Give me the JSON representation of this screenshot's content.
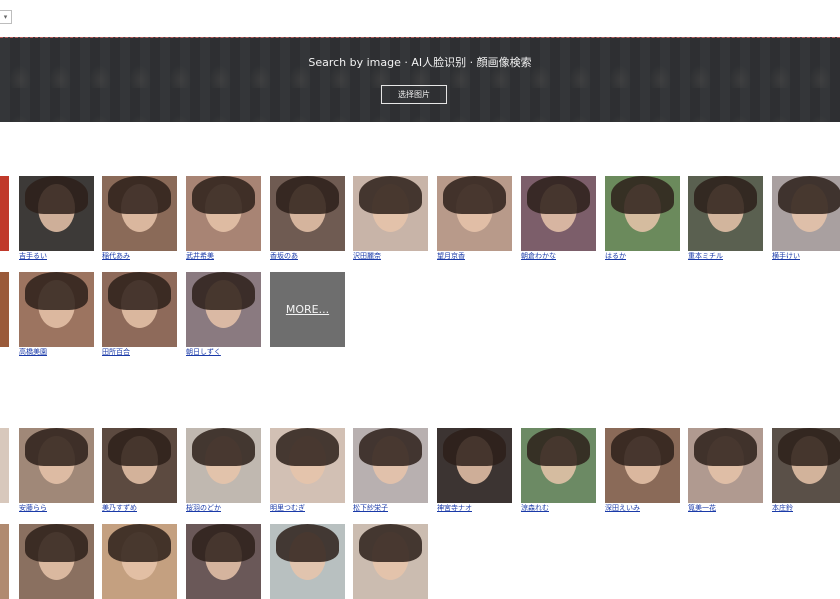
{
  "topbar": {
    "select_glyph": "▾"
  },
  "banner": {
    "title": "Search by image · AI人脸识别 · 顔画像検索",
    "button": "选择图片"
  },
  "sections": [
    {
      "rows": [
        {
          "cards": [
            {
              "name": "吉手るい",
              "photo": "#3d3a38"
            },
            {
              "name": "稲代あみ",
              "photo": "#8a6a58"
            },
            {
              "name": "武井希美",
              "photo": "#a88474"
            },
            {
              "name": "香坂のあ",
              "photo": "#6f5b52"
            },
            {
              "name": "沢田麗奈",
              "photo": "#c8b4a8"
            },
            {
              "name": "望月京香",
              "photo": "#b89a8a"
            },
            {
              "name": "朝倉わかな",
              "photo": "#7c5e6a"
            },
            {
              "name": "はるか",
              "photo": "#6b8a5c"
            },
            {
              "name": "重本ミチル",
              "photo": "#5a6050"
            },
            {
              "name": "横手けい",
              "photo": "#a9a0a0"
            }
          ]
        },
        {
          "cards": [
            {
              "name": "高橋美園",
              "photo": "#9c7460"
            },
            {
              "name": "田所百合",
              "photo": "#8e6a5a"
            },
            {
              "name": "朝日しずく",
              "photo": "#8a7a80"
            }
          ],
          "more": "MORE..."
        }
      ]
    },
    {
      "rows": [
        {
          "cards": [
            {
              "name": "安藤らら",
              "photo": "#a08878"
            },
            {
              "name": "美乃すずめ",
              "photo": "#5c4a40"
            },
            {
              "name": "桜羽のどか",
              "photo": "#c0b8b0"
            },
            {
              "name": "明里つむぎ",
              "photo": "#d2c0b4"
            },
            {
              "name": "松下紗栄子",
              "photo": "#b8b0b0"
            },
            {
              "name": "神宮寺ナオ",
              "photo": "#3c3432"
            },
            {
              "name": "涼森れむ",
              "photo": "#6c8a64"
            },
            {
              "name": "深田えいみ",
              "photo": "#8a6a58"
            },
            {
              "name": "筧美一花",
              "photo": "#b09a90"
            },
            {
              "name": "本庄鈴",
              "photo": "#5a5048"
            }
          ]
        },
        {
          "cards": [
            {
              "name": "",
              "photo": "#8a7060"
            },
            {
              "name": "",
              "photo": "#c4a080"
            },
            {
              "name": "",
              "photo": "#6a5858"
            },
            {
              "name": "",
              "photo": "#b8c0c0"
            },
            {
              "name": "",
              "photo": "#cbbcb0"
            }
          ]
        }
      ]
    }
  ]
}
